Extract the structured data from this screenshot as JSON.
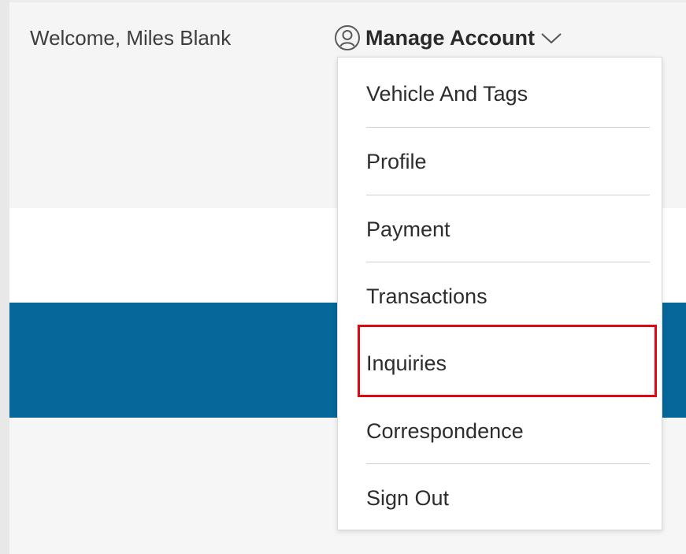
{
  "header": {
    "welcome_text": "Welcome, Miles Blank",
    "account_menu_label": "Manage Account"
  },
  "icons": {
    "user": "user-circle-icon",
    "chevron": "chevron-down-icon"
  },
  "account_menu": {
    "items": [
      {
        "label": "Vehicle And Tags"
      },
      {
        "label": "Profile"
      },
      {
        "label": "Payment"
      },
      {
        "label": "Transactions"
      },
      {
        "label": "Inquiries",
        "highlighted": true
      },
      {
        "label": "Correspondence"
      },
      {
        "label": "Sign Out"
      }
    ]
  },
  "colors": {
    "banner_blue": "#05679a",
    "highlight_red": "#e0080f",
    "page_background": "#f6f6f6"
  }
}
